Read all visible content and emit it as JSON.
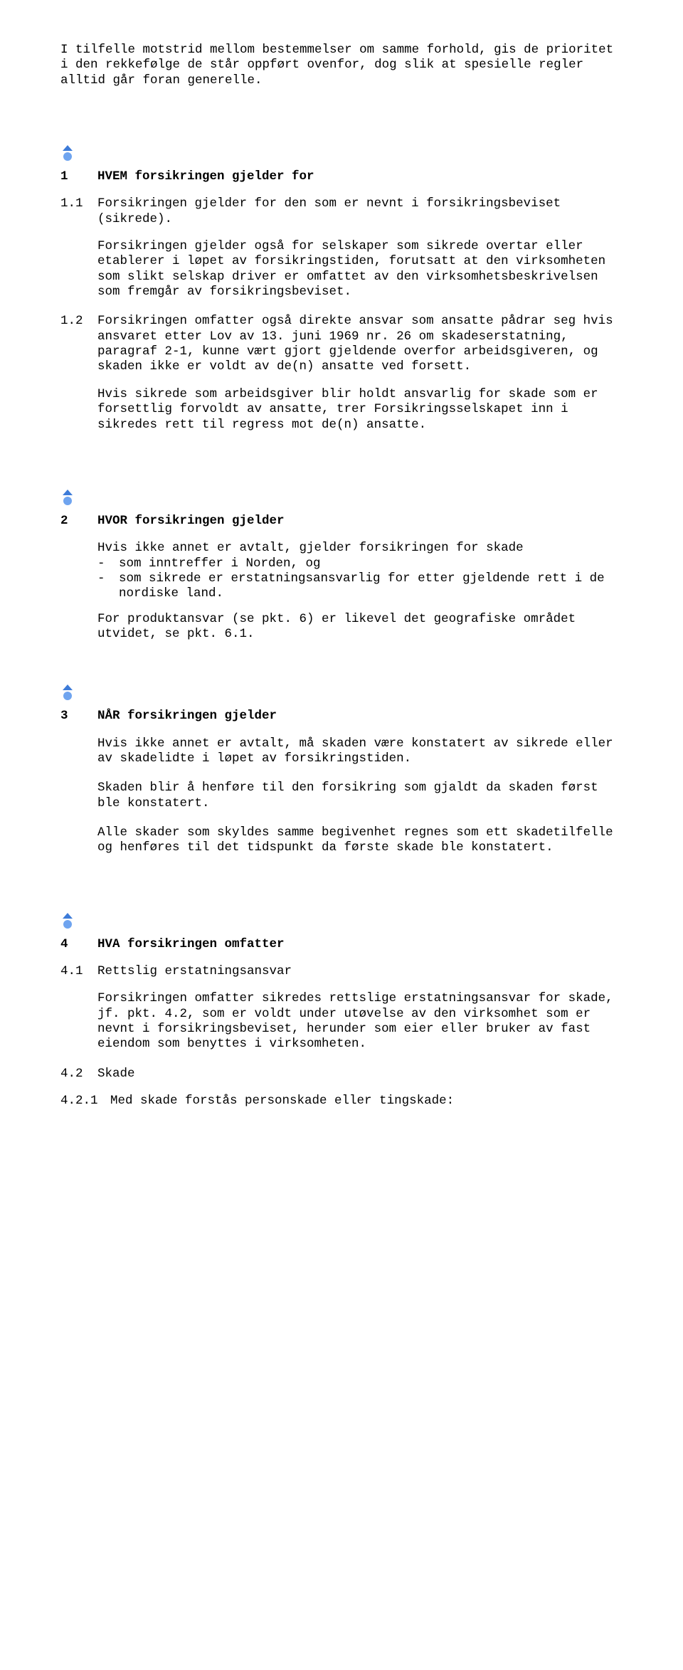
{
  "intro": "I tilfelle motstrid mellom bestemmelser om samme forhold, gis de prioritet i den rekkefølge de står oppført ovenfor, dog slik at spesielle regler alltid går foran generelle.",
  "s1": {
    "num": "1",
    "title": "HVEM forsikringen gjelder for",
    "p1_num": "1.1",
    "p1_a": "Forsikringen gjelder for den som er nevnt i forsikringsbeviset (sikrede).",
    "p1_b": "Forsikringen gjelder også for selskaper som sikrede overtar eller etablerer i løpet av forsikringstiden, forutsatt at den virksomheten som slikt selskap driver er omfattet av den virksomhetsbeskrivelsen som fremgår av forsikringsbeviset.",
    "p2_num": "1.2",
    "p2_a": "Forsikringen omfatter også direkte ansvar som ansatte pådrar seg hvis ansvaret etter Lov av 13. juni 1969 nr. 26 om skadeserstatning, paragraf 2-1, kunne vært gjort gjeldende overfor arbeidsgiveren, og skaden ikke er voldt av de(n) ansatte ved forsett.",
    "p2_b": "Hvis sikrede som arbeidsgiver blir holdt ansvarlig for skade som er forsettlig forvoldt av ansatte, trer Forsikringsselskapet inn i sikredes rett til regress mot de(n) ansatte."
  },
  "s2": {
    "num": "2",
    "title": "HVOR forsikringen gjelder",
    "p1": "Hvis ikke annet er avtalt, gjelder forsikringen for skade",
    "li1": "som inntreffer i Norden, og",
    "li2": "som sikrede er erstatningsansvarlig for etter gjeldende rett i de nordiske land.",
    "p2": "For produktansvar (se pkt. 6) er likevel det geografiske området utvidet, se pkt. 6.1."
  },
  "s3": {
    "num": "3",
    "title": "NÅR forsikringen gjelder",
    "p1": "Hvis ikke annet er avtalt, må skaden være konstatert av sikrede eller av skadelidte i løpet av forsikringstiden.",
    "p2": "Skaden blir å henføre til den forsikring som gjaldt da skaden først ble konstatert.",
    "p3": "Alle skader som skyldes samme begivenhet regnes som ett skadetilfelle og henføres til det tidspunkt da første skade ble konstatert."
  },
  "s4": {
    "num": "4",
    "title": "HVA forsikringen omfatter",
    "p1_num": "4.1",
    "p1_title": "Rettslig erstatningsansvar",
    "p1_body": "Forsikringen omfatter sikredes rettslige erstatningsansvar for skade, jf. pkt. 4.2, som er voldt under utøvelse av den virksomhet som er nevnt i forsikringsbeviset, herunder som eier eller bruker av fast eiendom som benyttes i virksomheten.",
    "p2_num": "4.2",
    "p2_title": "Skade",
    "p3_num": "4.2.1",
    "p3_body": "Med skade forstås personskade eller tingskade:"
  }
}
